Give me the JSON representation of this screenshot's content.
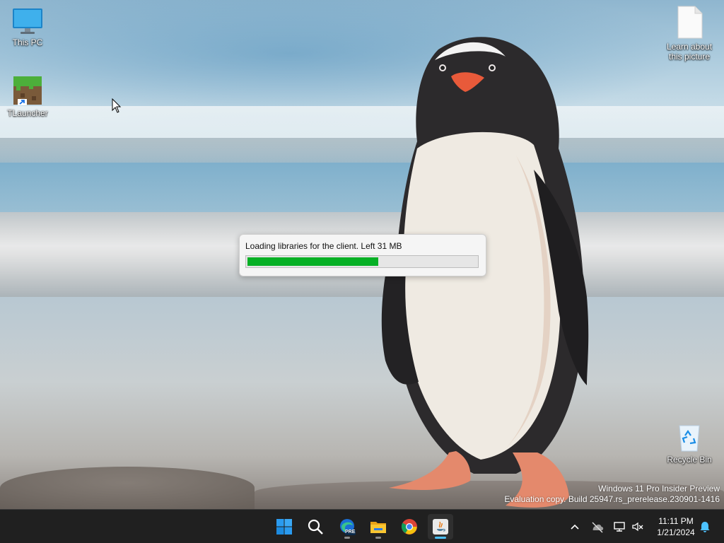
{
  "desktop": {
    "icons": [
      {
        "label": "This PC"
      },
      {
        "label": "TLauncher"
      },
      {
        "label": "Learn about this picture"
      },
      {
        "label": "Recycle Bin"
      }
    ]
  },
  "dialog": {
    "message": "Loading libraries for the client. Left 31 MB",
    "progress_fraction": 0.57,
    "progress_color": "#06b025"
  },
  "watermark": {
    "line1": "Windows 11 Pro Insider Preview",
    "line2": "Evaluation copy. Build 25947.rs_prerelease.230901-1416"
  },
  "taskbar": {
    "apps": [
      {
        "name": "start-icon"
      },
      {
        "name": "search-icon"
      },
      {
        "name": "edge-preview-icon",
        "badge": "PRE"
      },
      {
        "name": "file-explorer-icon"
      },
      {
        "name": "chrome-icon"
      },
      {
        "name": "java-icon"
      }
    ],
    "accent": "#4cc2ff"
  },
  "clock": {
    "time": "11:11 PM",
    "date": "1/21/2024"
  }
}
